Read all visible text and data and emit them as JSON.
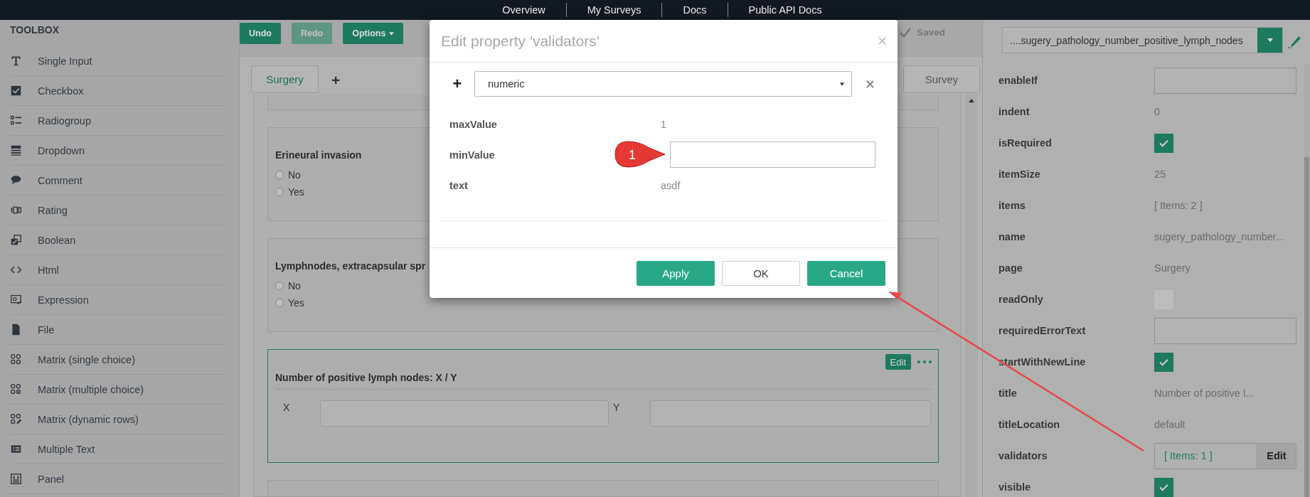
{
  "nav": {
    "links": [
      "Overview",
      "My Surveys",
      "Docs",
      "Public API Docs"
    ]
  },
  "toolbox": {
    "title": "TOOLBOX",
    "items": [
      {
        "kind": "text",
        "label": "Single Input"
      },
      {
        "kind": "checkbox",
        "label": "Checkbox"
      },
      {
        "kind": "radiogroup",
        "label": "Radiogroup"
      },
      {
        "kind": "dropdown",
        "label": "Dropdown"
      },
      {
        "kind": "comment",
        "label": "Comment"
      },
      {
        "kind": "rating",
        "label": "Rating"
      },
      {
        "kind": "boolean",
        "label": "Boolean"
      },
      {
        "kind": "html",
        "label": "Html"
      },
      {
        "kind": "expression",
        "label": "Expression"
      },
      {
        "kind": "file",
        "label": "File"
      },
      {
        "kind": "matrix",
        "label": "Matrix (single choice)"
      },
      {
        "kind": "matrixdropdown",
        "label": "Matrix (multiple choice)"
      },
      {
        "kind": "matrixdynamic",
        "label": "Matrix (dynamic rows)"
      },
      {
        "kind": "multipletext",
        "label": "Multiple Text"
      },
      {
        "kind": "panel",
        "label": "Panel"
      }
    ]
  },
  "toolbar": {
    "buttons": [
      {
        "label": "Undo",
        "disabled": false,
        "dropdown": false
      },
      {
        "label": "Redo",
        "disabled": true,
        "dropdown": false
      },
      {
        "label": "Options",
        "disabled": false,
        "dropdown": true
      }
    ],
    "status": "Saved"
  },
  "pages": {
    "tabs": [
      {
        "label": "Surgery",
        "selected": true
      }
    ],
    "add": "+",
    "survey_button": "Survey"
  },
  "questions": [
    {
      "kind": "blank",
      "selected": false
    },
    {
      "kind": "radiogroup",
      "selected": false,
      "title": "Erineural invasion",
      "choices": [
        {
          "label": "No",
          "checked": false
        },
        {
          "label": "Yes",
          "checked": false
        }
      ]
    },
    {
      "kind": "radiogroup",
      "selected": false,
      "title": "Lymphnodes, extracapsular spr",
      "choices": [
        {
          "label": "No",
          "checked": false
        },
        {
          "label": "Yes",
          "checked": false
        }
      ]
    },
    {
      "kind": "multipletext",
      "selected": true,
      "title": "Number of positive lymph nodes: X / Y",
      "edit": "Edit",
      "items": [
        {
          "label": "X"
        },
        {
          "label": "Y"
        }
      ]
    },
    {
      "kind": "blank",
      "selected": false
    }
  ],
  "properties": {
    "selector": "....sugery_pathology_number_positive_lymph_nodes",
    "rows": [
      {
        "kind": "input",
        "label": "enableIf"
      },
      {
        "kind": "text",
        "label": "indent",
        "value": "0"
      },
      {
        "kind": "checkbox",
        "label": "isRequired",
        "checked": true
      },
      {
        "kind": "text",
        "label": "itemSize",
        "value": "25"
      },
      {
        "kind": "text",
        "label": "items",
        "value": "[ Items: 2 ]"
      },
      {
        "kind": "text",
        "label": "name",
        "value": "sugery_pathology_number..."
      },
      {
        "kind": "text",
        "label": "page",
        "value": "Surgery"
      },
      {
        "kind": "checkbox",
        "label": "readOnly",
        "checked": false
      },
      {
        "kind": "input",
        "label": "requiredErrorText"
      },
      {
        "kind": "checkbox",
        "label": "startWithNewLine",
        "checked": true
      },
      {
        "kind": "text",
        "label": "title",
        "value": "Number of positive l..."
      },
      {
        "kind": "text",
        "label": "titleLocation",
        "value": "default"
      },
      {
        "kind": "editor",
        "label": "validators",
        "value": "[ Items: 1 ]",
        "button": "Edit"
      },
      {
        "kind": "checkbox",
        "label": "visible",
        "checked": true
      }
    ]
  },
  "modal": {
    "title": "Edit property 'validators'",
    "add": "+",
    "validator": "numeric",
    "rows": [
      {
        "kind": "text",
        "label": "maxValue",
        "value": "1"
      },
      {
        "kind": "input",
        "label": "minValue",
        "callout": "1"
      },
      {
        "kind": "text",
        "label": "text",
        "value": "asdf"
      }
    ],
    "buttons": [
      {
        "label": "Apply",
        "kind": "primary"
      },
      {
        "label": "OK",
        "kind": "secondary"
      },
      {
        "label": "Cancel",
        "kind": "primary"
      }
    ]
  }
}
